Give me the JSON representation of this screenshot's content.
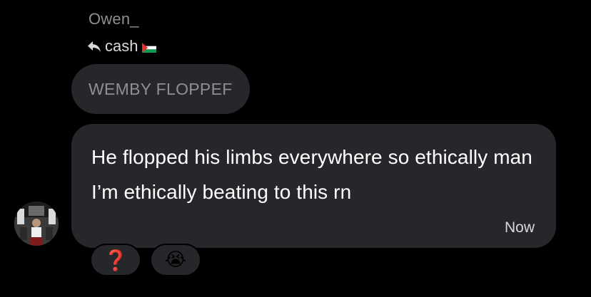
{
  "conversation": {
    "sender_name": "Owen_",
    "reply_indicator": {
      "icon": "reply-arrow-icon",
      "label": "cash",
      "flag_icon": "palestine-flag-icon"
    },
    "quoted_message": "WEMBY FLOPPEF",
    "message": {
      "text": "He flopped his limbs everywhere so ethically man I’m ethically beating to this rn",
      "timestamp": "Now"
    },
    "avatar_icon": "user-avatar",
    "reactions": [
      {
        "emoji": "❓",
        "icon": "question-mark-icon"
      },
      {
        "emoji": "😭",
        "icon": "crying-face-icon"
      }
    ]
  },
  "colors": {
    "background": "#000000",
    "bubble": "#26272b",
    "primary_text": "#ffffff",
    "secondary_text": "#8e8e93",
    "question_red": "#e0231f"
  }
}
